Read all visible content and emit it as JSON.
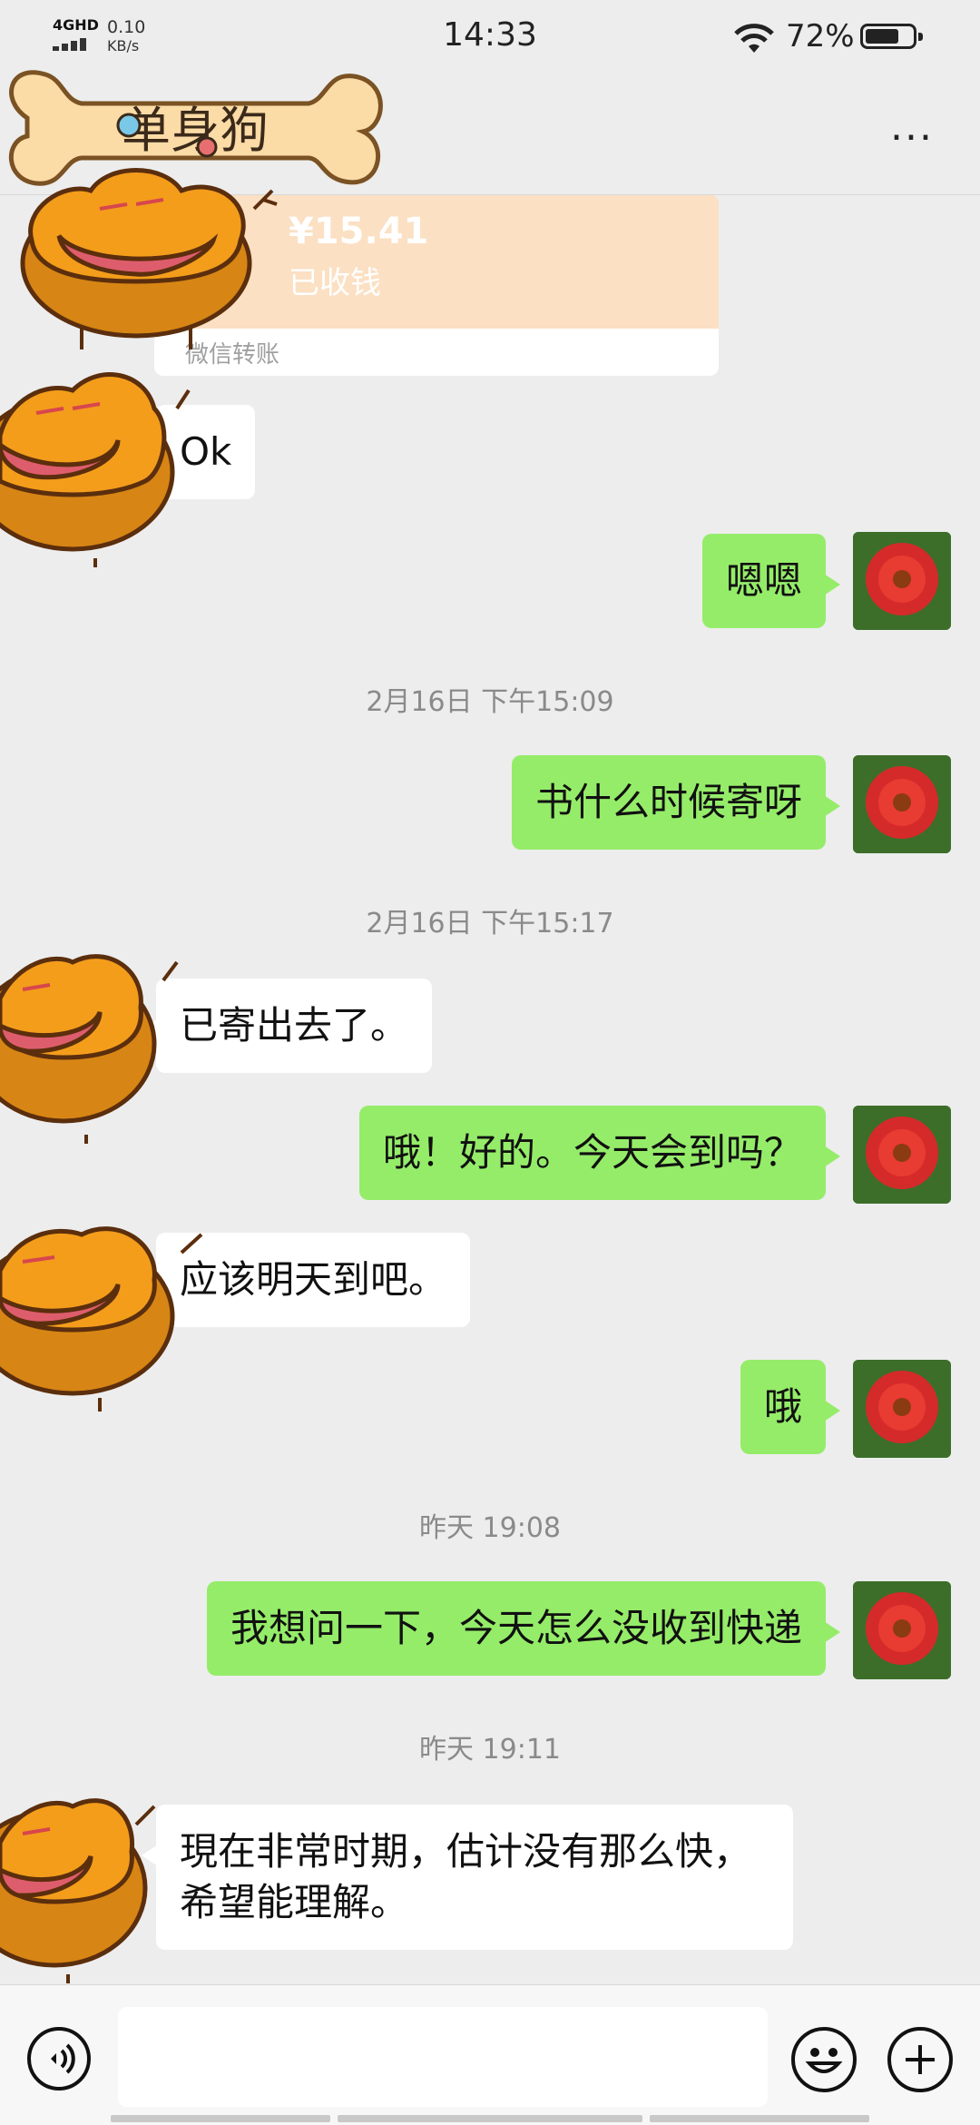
{
  "status_bar": {
    "network": "4GHD",
    "speed": "0.10\nKB/s",
    "speed_value": "0.10",
    "speed_unit": "KB/s",
    "time": "14:33",
    "battery": "72%",
    "battery_level": 0.72,
    "icons": [
      "signal-icon",
      "wifi-icon",
      "battery-icon"
    ]
  },
  "header": {
    "title_sticker_text": "单身狗",
    "more_label": "..."
  },
  "transfer_card": {
    "amount": "¥15.41",
    "status": "已收钱",
    "footer": "微信转账"
  },
  "messages": [
    {
      "side": "left",
      "text": "Ok"
    },
    {
      "side": "right",
      "text": "嗯嗯"
    },
    {
      "type": "timestamp",
      "text": "2月16日 下午15:09"
    },
    {
      "side": "right",
      "text": "书什么时候寄呀"
    },
    {
      "type": "timestamp",
      "text": "2月16日 下午15:17"
    },
    {
      "side": "left",
      "text": "已寄出去了。"
    },
    {
      "side": "right",
      "text": "哦！好的。今天会到吗？"
    },
    {
      "side": "left",
      "text": "应该明天到吧。"
    },
    {
      "side": "right",
      "text": "哦"
    },
    {
      "type": "timestamp",
      "text": "昨天 19:08"
    },
    {
      "side": "right",
      "text": "我想问一下，今天怎么没收到快递"
    },
    {
      "type": "timestamp",
      "text": "昨天 19:11"
    },
    {
      "side": "left",
      "text": "現在非常时期，估计没有那么快，",
      "text2": "希望能理解。"
    }
  ],
  "input_bar": {
    "text_value": "",
    "icons": [
      "voice-icon",
      "emoji-icon",
      "plus-icon"
    ]
  },
  "colors": {
    "background": "#ededed",
    "sent_bubble": "#95ec69",
    "received_bubble": "#ffffff",
    "transfer_card": "#fbe0c3"
  }
}
